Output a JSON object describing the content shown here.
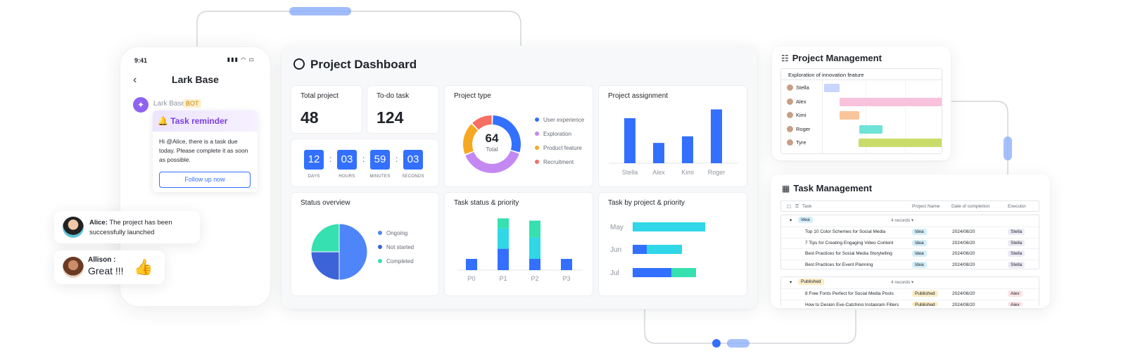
{
  "colors": {
    "primary": "#3370ff",
    "cyan": "#2fd7e7",
    "teal": "#36e0b0",
    "purple": "#c488f2",
    "orange": "#f7a823",
    "red": "#f76e63",
    "bot_purple": "#8f63f0"
  },
  "phone": {
    "time": "9:41",
    "status_icons": "▮▮▮ ◠ ▭",
    "back_icon": "chevron-left-icon",
    "title": "Lark Base",
    "bot_name": "Lark Base",
    "bot_tag": "BOT",
    "reminder_title": "🔔 Task reminder",
    "reminder_text": "Hi @Alice, there is a task due today. Please complete it as soon as possible.",
    "follow_button": "Follow up now"
  },
  "chats": [
    {
      "name": "Alice:",
      "message": "The project has been successfully launched"
    },
    {
      "name": "Allison :",
      "message": "Great !!!",
      "emoji_icon": "thumbs-up-icon"
    }
  ],
  "dashboard": {
    "title": "Project Dashboard",
    "total_project": {
      "label": "Total project",
      "value": "48"
    },
    "todo_task": {
      "label": "To-do task",
      "value": "124"
    },
    "countdown": [
      {
        "value": "12",
        "label": "DAYS"
      },
      {
        "value": "03",
        "label": "HOURS"
      },
      {
        "value": "59",
        "label": "MINUTES"
      },
      {
        "value": "03",
        "label": "SECONDS"
      }
    ],
    "project_type": {
      "title": "Project type",
      "center_value": "64",
      "center_label": "Total"
    },
    "project_assignment": {
      "title": "Project assignment"
    },
    "status_overview": {
      "title": "Status overview"
    },
    "task_status_priority": {
      "title": "Task status & priority"
    },
    "task_by_project": {
      "title": "Task by project & priority"
    }
  },
  "chart_data": [
    {
      "type": "pie",
      "title": "Project type",
      "labels": [
        "User experience",
        "Exploration",
        "Product feature",
        "Recruitment"
      ],
      "values": [
        19,
        25,
        12,
        8
      ],
      "colors": [
        "#3370ff",
        "#c488f2",
        "#f7a823",
        "#f76e63"
      ],
      "center_text": "64 Total"
    },
    {
      "type": "bar",
      "title": "Project assignment",
      "categories": [
        "Stella",
        "Alex",
        "Kimi",
        "Roger"
      ],
      "values": [
        8.2,
        3.7,
        4.9,
        9.8
      ],
      "ylim": [
        0,
        10
      ]
    },
    {
      "type": "pie",
      "title": "Status overview",
      "labels": [
        "Ongoing",
        "Not started",
        "Completed"
      ],
      "values": [
        50,
        25,
        25
      ],
      "colors": [
        "#4e85f8",
        "#3d63d9",
        "#36e0b0"
      ]
    },
    {
      "type": "bar",
      "title": "Task status & priority",
      "categories": [
        "P0",
        "P1",
        "P2",
        "P3"
      ],
      "series": [
        {
          "values": [
            1.0,
            1.9,
            1.0,
            1.0
          ],
          "color": "#3370ff"
        },
        {
          "values": [
            0,
            1.8,
            1.9,
            0
          ],
          "color": "#2fd7e7"
        },
        {
          "values": [
            0,
            0.9,
            1.5,
            0
          ],
          "color": "#36e0b0"
        }
      ],
      "ylim": [
        0,
        5
      ]
    },
    {
      "type": "bar",
      "title": "Task by project & priority",
      "orientation": "horizontal",
      "categories": [
        "May",
        "Jun",
        "Jul"
      ],
      "series": [
        {
          "values": [
            0,
            2.0,
            5.5
          ],
          "color": "#3370ff"
        },
        {
          "values": [
            10.3,
            5.0,
            0
          ],
          "color": "#2fd7e7"
        },
        {
          "values": [
            0,
            0,
            3.5
          ],
          "color": "#36e0b0"
        }
      ],
      "xlim": [
        0,
        10.3
      ]
    }
  ],
  "project_management": {
    "title": "Project Management",
    "header": "Exploration of innovation feature",
    "people": [
      "Stella",
      "Alex",
      "Kimi",
      "Roger",
      "Tyre"
    ],
    "bar_colors": [
      "#c9d6fb",
      "#f8c1dc",
      "#f9c59a",
      "#6fe3d8",
      "#c9dc6a"
    ]
  },
  "task_management": {
    "title": "Task Management",
    "columns": [
      "Task",
      "Project Name",
      "Date of completion",
      "Executor"
    ],
    "groups": [
      {
        "name": "Idea",
        "records": "4 records",
        "chip_color": "#d4eef9",
        "rows": [
          {
            "task": "Top 10 Color Schemes for Social Media",
            "project": "Idea",
            "date": "2024/08/20",
            "executor": "Stella"
          },
          {
            "task": "7 Tips for Creating Engaging Video Content",
            "project": "Idea",
            "date": "2024/08/20",
            "executor": "Stella"
          },
          {
            "task": "Best Practices for Social Media Storytelling",
            "project": "Idea",
            "date": "2024/08/20",
            "executor": "Stella"
          },
          {
            "task": "Best Practices for Event Planning",
            "project": "Idea",
            "date": "2024/08/20",
            "executor": "Stella"
          }
        ]
      },
      {
        "name": "Published",
        "records": "4 records",
        "chip_color": "#fbecc6",
        "rows": [
          {
            "task": "8 Free Fonts Perfect for Social Media Posts",
            "project": "Published",
            "date": "2024/08/20",
            "executor": "Alex"
          },
          {
            "task": "How to Design Eye-Catching Instagram Filters",
            "project": "Published",
            "date": "2024/08/20",
            "executor": "Alex"
          }
        ]
      }
    ]
  }
}
